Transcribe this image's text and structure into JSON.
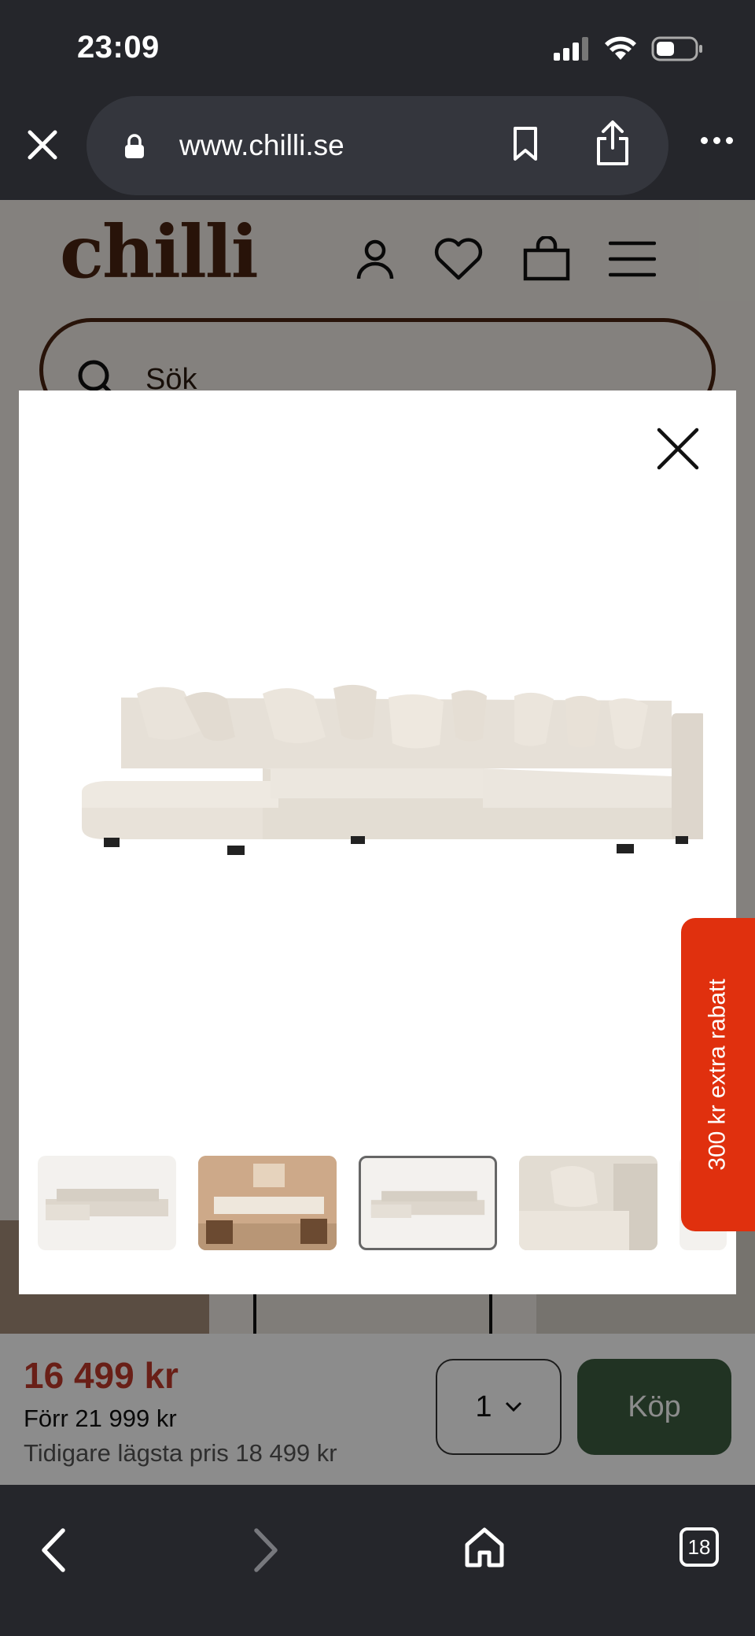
{
  "status": {
    "time": "23:09"
  },
  "browser": {
    "url": "www.chilli.se",
    "tab_count": "18"
  },
  "site": {
    "logo": "chilli",
    "search_placeholder": "Sök"
  },
  "product": {
    "price": "16 499 kr",
    "old_price": "Förr 21 999 kr",
    "lowest_price": "Tidigare lägsta pris 18 499 kr",
    "quantity": "1",
    "buy_label": "Köp"
  },
  "promo": {
    "label": "300 kr extra rabatt"
  },
  "gallery": {
    "thumbnail_count": 5,
    "active_thumbnail_index": 2
  },
  "colors": {
    "browser_chrome": "#25262b",
    "brand_brown": "#4a2411",
    "price_red": "#c0392b",
    "buy_green": "#3d5e41",
    "promo_orange": "#e0300e"
  }
}
